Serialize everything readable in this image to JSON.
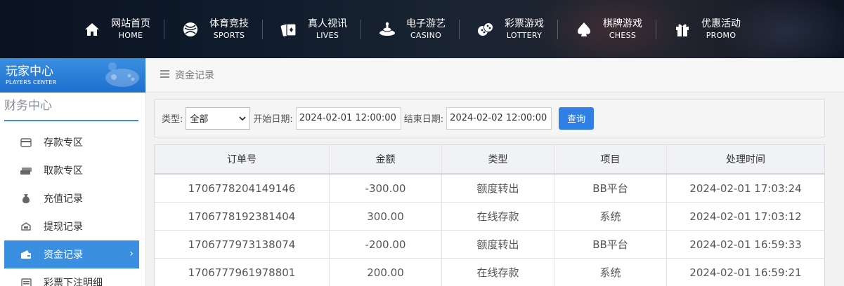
{
  "nav": {
    "items": [
      {
        "cn": "网站首页",
        "en": "HOME",
        "icon": "home-icon"
      },
      {
        "cn": "体育竞技",
        "en": "SPORTS",
        "icon": "ball-icon"
      },
      {
        "cn": "真人视讯",
        "en": "LIVES",
        "icon": "cards-icon"
      },
      {
        "cn": "电子游艺",
        "en": "CASINO",
        "icon": "slot-icon"
      },
      {
        "cn": "彩票游戏",
        "en": "LOTTERY",
        "icon": "dice-icon"
      },
      {
        "cn": "棋牌游戏",
        "en": "CHESS",
        "icon": "spade-icon"
      },
      {
        "cn": "优惠活动",
        "en": "PROMO",
        "icon": "gift-icon"
      }
    ]
  },
  "sidebar": {
    "title": "玩家中心",
    "subtitle": "PLAYERS CENTER",
    "section": "财务中心",
    "items": [
      {
        "label": "存款专区",
        "icon": "deposit-icon"
      },
      {
        "label": "取款专区",
        "icon": "withdraw-icon"
      },
      {
        "label": "充值记录",
        "icon": "moneybag-icon"
      },
      {
        "label": "提现记录",
        "icon": "cash-out-icon"
      },
      {
        "label": "资金记录",
        "icon": "funds-icon",
        "active": true
      },
      {
        "label": "彩票下注明细",
        "icon": "lottery-record-icon"
      }
    ],
    "chevron": "›"
  },
  "main": {
    "breadcrumb": "资金记录",
    "filter": {
      "type_label": "类型:",
      "type_value": "全部",
      "start_label": "开始日期:",
      "start_value": "2024-02-01 12:00:00",
      "end_label": "结束日期:",
      "end_value": "2024-02-02 12:00:00",
      "query_label": "查询"
    },
    "table": {
      "headers": [
        "订单号",
        "金额",
        "类型",
        "项目",
        "处理时间"
      ],
      "rows": [
        [
          "1706778204149146",
          "-300.00",
          "额度转出",
          "BB平台",
          "2024-02-01 17:03:24"
        ],
        [
          "1706778192381404",
          "300.00",
          "在线存款",
          "系统",
          "2024-02-01 17:03:12"
        ],
        [
          "1706777973138074",
          "-200.00",
          "额度转出",
          "BB平台",
          "2024-02-01 16:59:33"
        ],
        [
          "1706777961978801",
          "200.00",
          "在线存款",
          "系统",
          "2024-02-01 16:59:21"
        ]
      ]
    }
  },
  "colors": {
    "accent": "#3a8fe0",
    "button": "#2f7fe6",
    "nav_bg": "#101c2c"
  }
}
